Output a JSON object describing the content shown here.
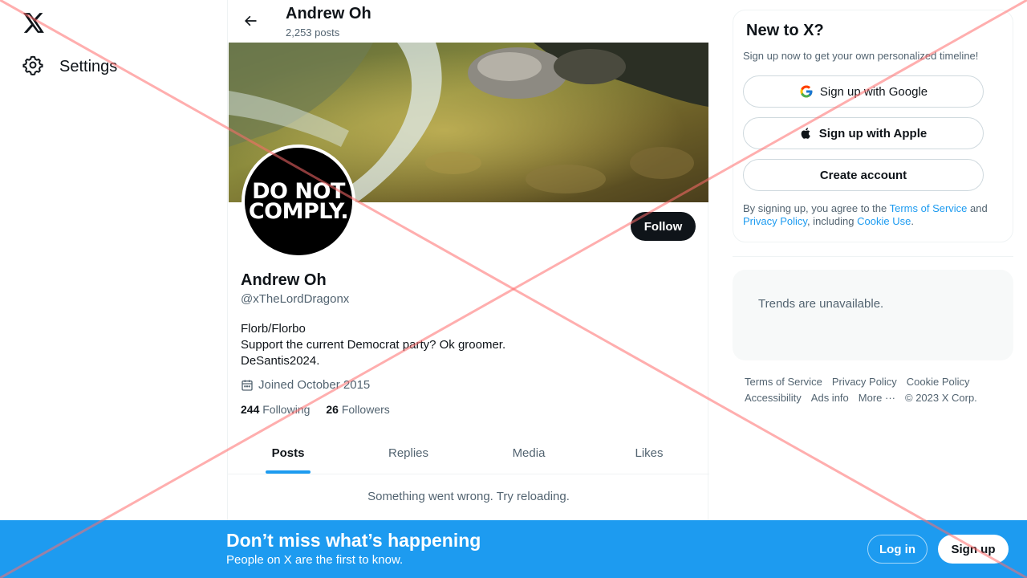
{
  "header": {
    "title": "Andrew Oh",
    "post_count": "2,253 posts"
  },
  "nav": {
    "settings_label": "Settings"
  },
  "profile": {
    "avatar_lines": [
      "DO NOT",
      "COMPLY."
    ],
    "follow_label": "Follow",
    "name": "Andrew Oh",
    "handle": "@xTheLordDragonx",
    "bio_lines": [
      "Florb/Florbo",
      "Support the current Democrat party? Ok groomer.",
      "DeSantis2024."
    ],
    "joined": "Joined October 2015",
    "following_count": "244",
    "following_label": "Following",
    "followers_count": "26",
    "followers_label": "Followers"
  },
  "tabs": [
    {
      "label": "Posts",
      "active": true
    },
    {
      "label": "Replies",
      "active": false
    },
    {
      "label": "Media",
      "active": false
    },
    {
      "label": "Likes",
      "active": false
    }
  ],
  "timeline": {
    "error": "Something went wrong. Try reloading."
  },
  "sidebar": {
    "signup_card": {
      "title": "New to X?",
      "subtitle": "Sign up now to get your own personalized timeline!",
      "google_label": "Sign up with Google",
      "apple_label": "Sign up with Apple",
      "create_label": "Create account",
      "terms_prefix": "By signing up, you agree to the ",
      "terms_link": "Terms of Service",
      "terms_and": " and ",
      "privacy_link": "Privacy Policy",
      "terms_including": ", including ",
      "cookie_link": "Cookie Use",
      "terms_end": "."
    },
    "trends": {
      "text": "Trends are unavailable."
    },
    "footer": {
      "row1": [
        "Terms of Service",
        "Privacy Policy",
        "Cookie Policy"
      ],
      "row2": [
        "Accessibility",
        "Ads info",
        "More ···",
        "© 2023 X Corp."
      ]
    }
  },
  "bottom_bar": {
    "headline": "Don’t miss what’s happening",
    "subline": "People on X are the first to know.",
    "login_label": "Log in",
    "signup_label": "Sign up"
  },
  "colors": {
    "accent": "#1d9bf0",
    "text_primary": "#0f1419",
    "text_secondary": "#536471",
    "overlay_cross": "#ff6b6b"
  },
  "icons": [
    "x-logo-icon",
    "gear-icon",
    "back-arrow-icon",
    "calendar-icon",
    "google-icon",
    "apple-icon"
  ]
}
